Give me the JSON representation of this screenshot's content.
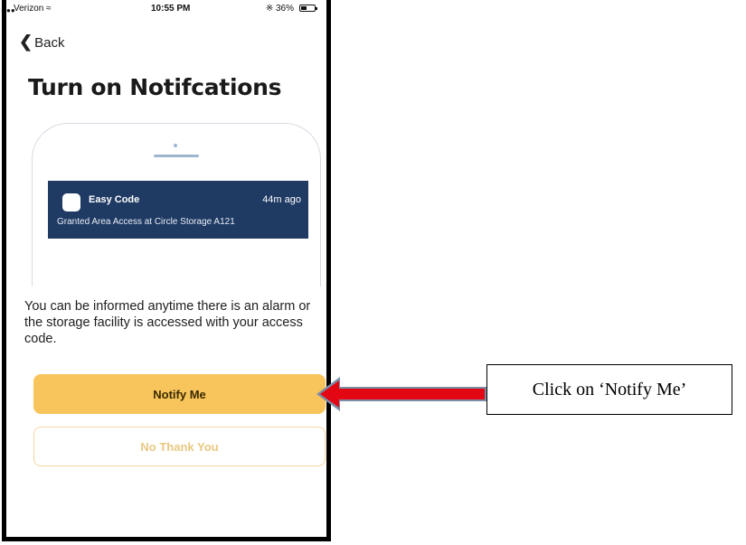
{
  "status_bar": {
    "carrier": "Verizon",
    "wifi_icon": "wifi-icon",
    "time": "10:55 PM",
    "bluetooth_icon": "bluetooth-icon",
    "battery_percent": "36%"
  },
  "nav": {
    "back_label": "Back"
  },
  "page": {
    "title": "Turn on Notifcations"
  },
  "notification_preview": {
    "app_name": "Easy Code",
    "time_ago": "44m ago",
    "message": "Granted Area Access at Circle Storage A121"
  },
  "info_text": "You can be informed anytime there is an alarm or the storage facility is accessed with your access code.",
  "buttons": {
    "primary": "Notify Me",
    "secondary": "No Thank You"
  },
  "annotation": {
    "callout": "Click on ‘Notify Me’",
    "arrow_color": "#e30613"
  },
  "colors": {
    "primary_button": "#f8c55c",
    "notification_bg": "#1f3a63"
  }
}
